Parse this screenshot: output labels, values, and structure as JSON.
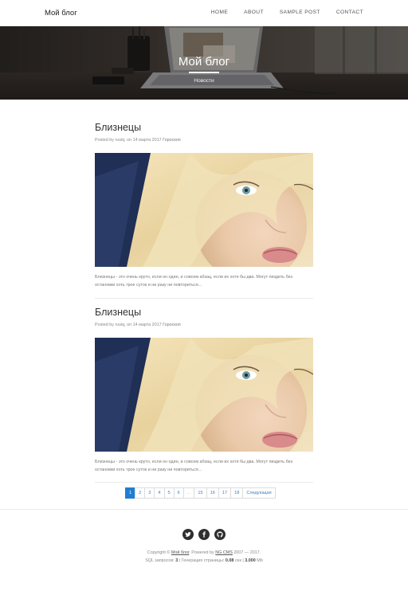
{
  "nav": {
    "brand": "Мой блог",
    "links": [
      "HOME",
      "ABOUT",
      "SAMPLE POST",
      "CONTACT"
    ]
  },
  "hero": {
    "title": "Мой блог",
    "subtitle": "Новости"
  },
  "posts": [
    {
      "title": "Близнецы",
      "meta_prefix": "Posted by rusiq, on 14 марта 2017",
      "category": "Гороскоп",
      "text": "Близнецы - это очень круто, если он один, и совсем абзац, если их хотя бы два. Могут пиздеть без остановки хоть трое суток и ни разу ни повториться..."
    },
    {
      "title": "Близнецы",
      "meta_prefix": "Posted by rusiq, on 14 марта 2017",
      "category": "Гороскоп",
      "text": "Близнецы - это очень круто, если он один, и совсем абзац, если их хотя бы два. Могут пиздеть без остановки хоть трое суток и ни разу ни повториться..."
    }
  ],
  "pagination": {
    "pages": [
      "1",
      "2",
      "3",
      "4",
      "5",
      "6",
      "...",
      "15",
      "16",
      "17",
      "18"
    ],
    "active": "1",
    "next": "Следующая"
  },
  "social": [
    "twitter-icon",
    "facebook-icon",
    "github-icon"
  ],
  "footer": {
    "copyright_prefix": "Copyright ©",
    "site_link": "Мой блог",
    "powered_prefix": ". Powered by",
    "cms_link": "NG CMS",
    "years": "2007 — 2017.",
    "sql_label": "SQL запросов:",
    "sql_count": "3",
    "gen_label": "| Генерация страницы:",
    "gen_time": "0.08",
    "gen_unit": "сек |",
    "mem": "3.000",
    "mem_unit": "Mb"
  },
  "colors": {
    "accent": "#1f7ed4",
    "link": "#3b7ec9",
    "social_bg": "#2f2f2f"
  }
}
